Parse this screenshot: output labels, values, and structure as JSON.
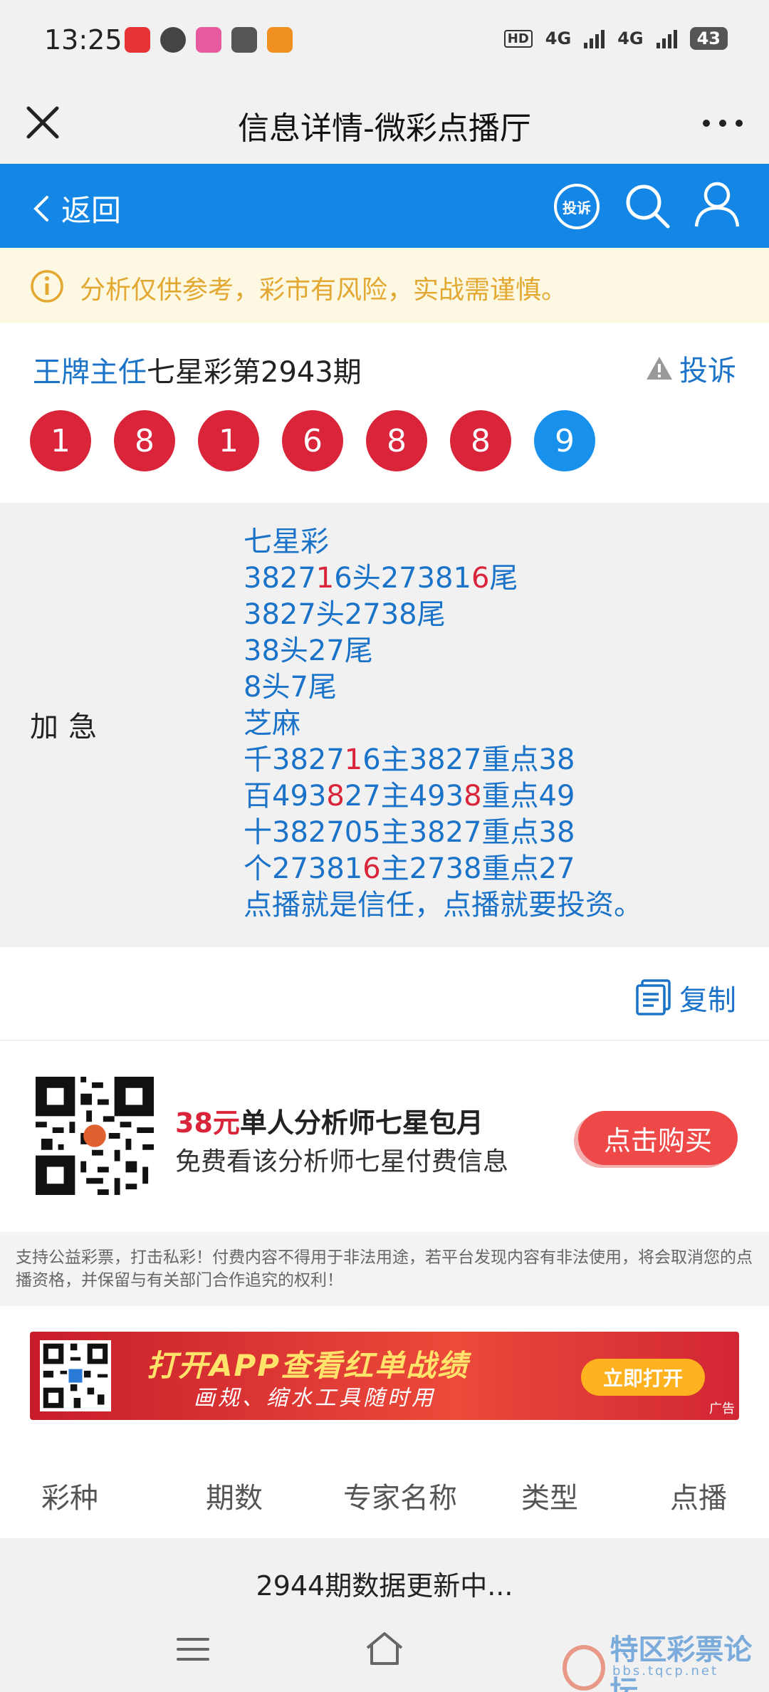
{
  "status_bar": {
    "time": "13:25",
    "signal_1": "4G",
    "signal_2": "4G",
    "battery": "43"
  },
  "title_bar": {
    "title": "信息详情-微彩点播厅"
  },
  "nav": {
    "back_label": "返回",
    "complain_icon_label": "投诉",
    "accent_color": "#1487e6"
  },
  "notice": {
    "text": "分析仅供参考，彩市有风险，实战需谨慎。"
  },
  "post": {
    "expert_name": "王牌主任",
    "issue_title": "七星彩第2943期",
    "report_label": "投诉",
    "balls": [
      "1",
      "8",
      "1",
      "6",
      "8",
      "8",
      "9"
    ],
    "content_label": "加急",
    "lines": [
      {
        "a": "七星彩",
        "h": "",
        "b": ""
      },
      {
        "a": "38271",
        "h": "",
        "b": "6头27381",
        "h2": "6",
        "c": "尾"
      },
      {
        "a": "3827头2738尾",
        "h": "",
        "b": ""
      },
      {
        "a": "38头27尾",
        "h": "",
        "b": ""
      },
      {
        "a": "8头7尾",
        "h": "",
        "b": ""
      },
      {
        "a": "芝麻",
        "h": "",
        "b": ""
      },
      {
        "a": "千382716主3827重点38",
        "h": "",
        "b": ""
      },
      {
        "a": "百4938",
        "h": "",
        "b": "27主4938重点49"
      },
      {
        "a": "十382705主3827重点38",
        "h": "",
        "b": ""
      },
      {
        "a": "个27381",
        "h": "6",
        "b": "主2738重点27"
      },
      {
        "a": "点播就是信任，点播就要投资。",
        "h": "",
        "b": ""
      }
    ],
    "copy_label": "复制"
  },
  "promo": {
    "price": "38元",
    "title_rest": "单人分析师七星包月",
    "subtitle": "免费看该分析师七星付费信息",
    "buy_label": "点击购买"
  },
  "disclaimer": "支持公益彩票，打击私彩！付费内容不得用于非法用途，若平台发现内容有非法使用，将会取消您的点播资格，并保留与有关部门合作追究的权利！",
  "banner": {
    "title": "打开APP查看红单战绩",
    "subtitle": "画规、缩水工具随时用",
    "button": "立即打开",
    "ad_tag": "广告"
  },
  "table": {
    "headers": [
      "彩种",
      "期数",
      "专家名称",
      "类型",
      "点播"
    ],
    "status_row": "2944期数据更新中..."
  },
  "watermark": {
    "text": "特区彩票论坛",
    "url": "bbs.tqcp.net"
  }
}
